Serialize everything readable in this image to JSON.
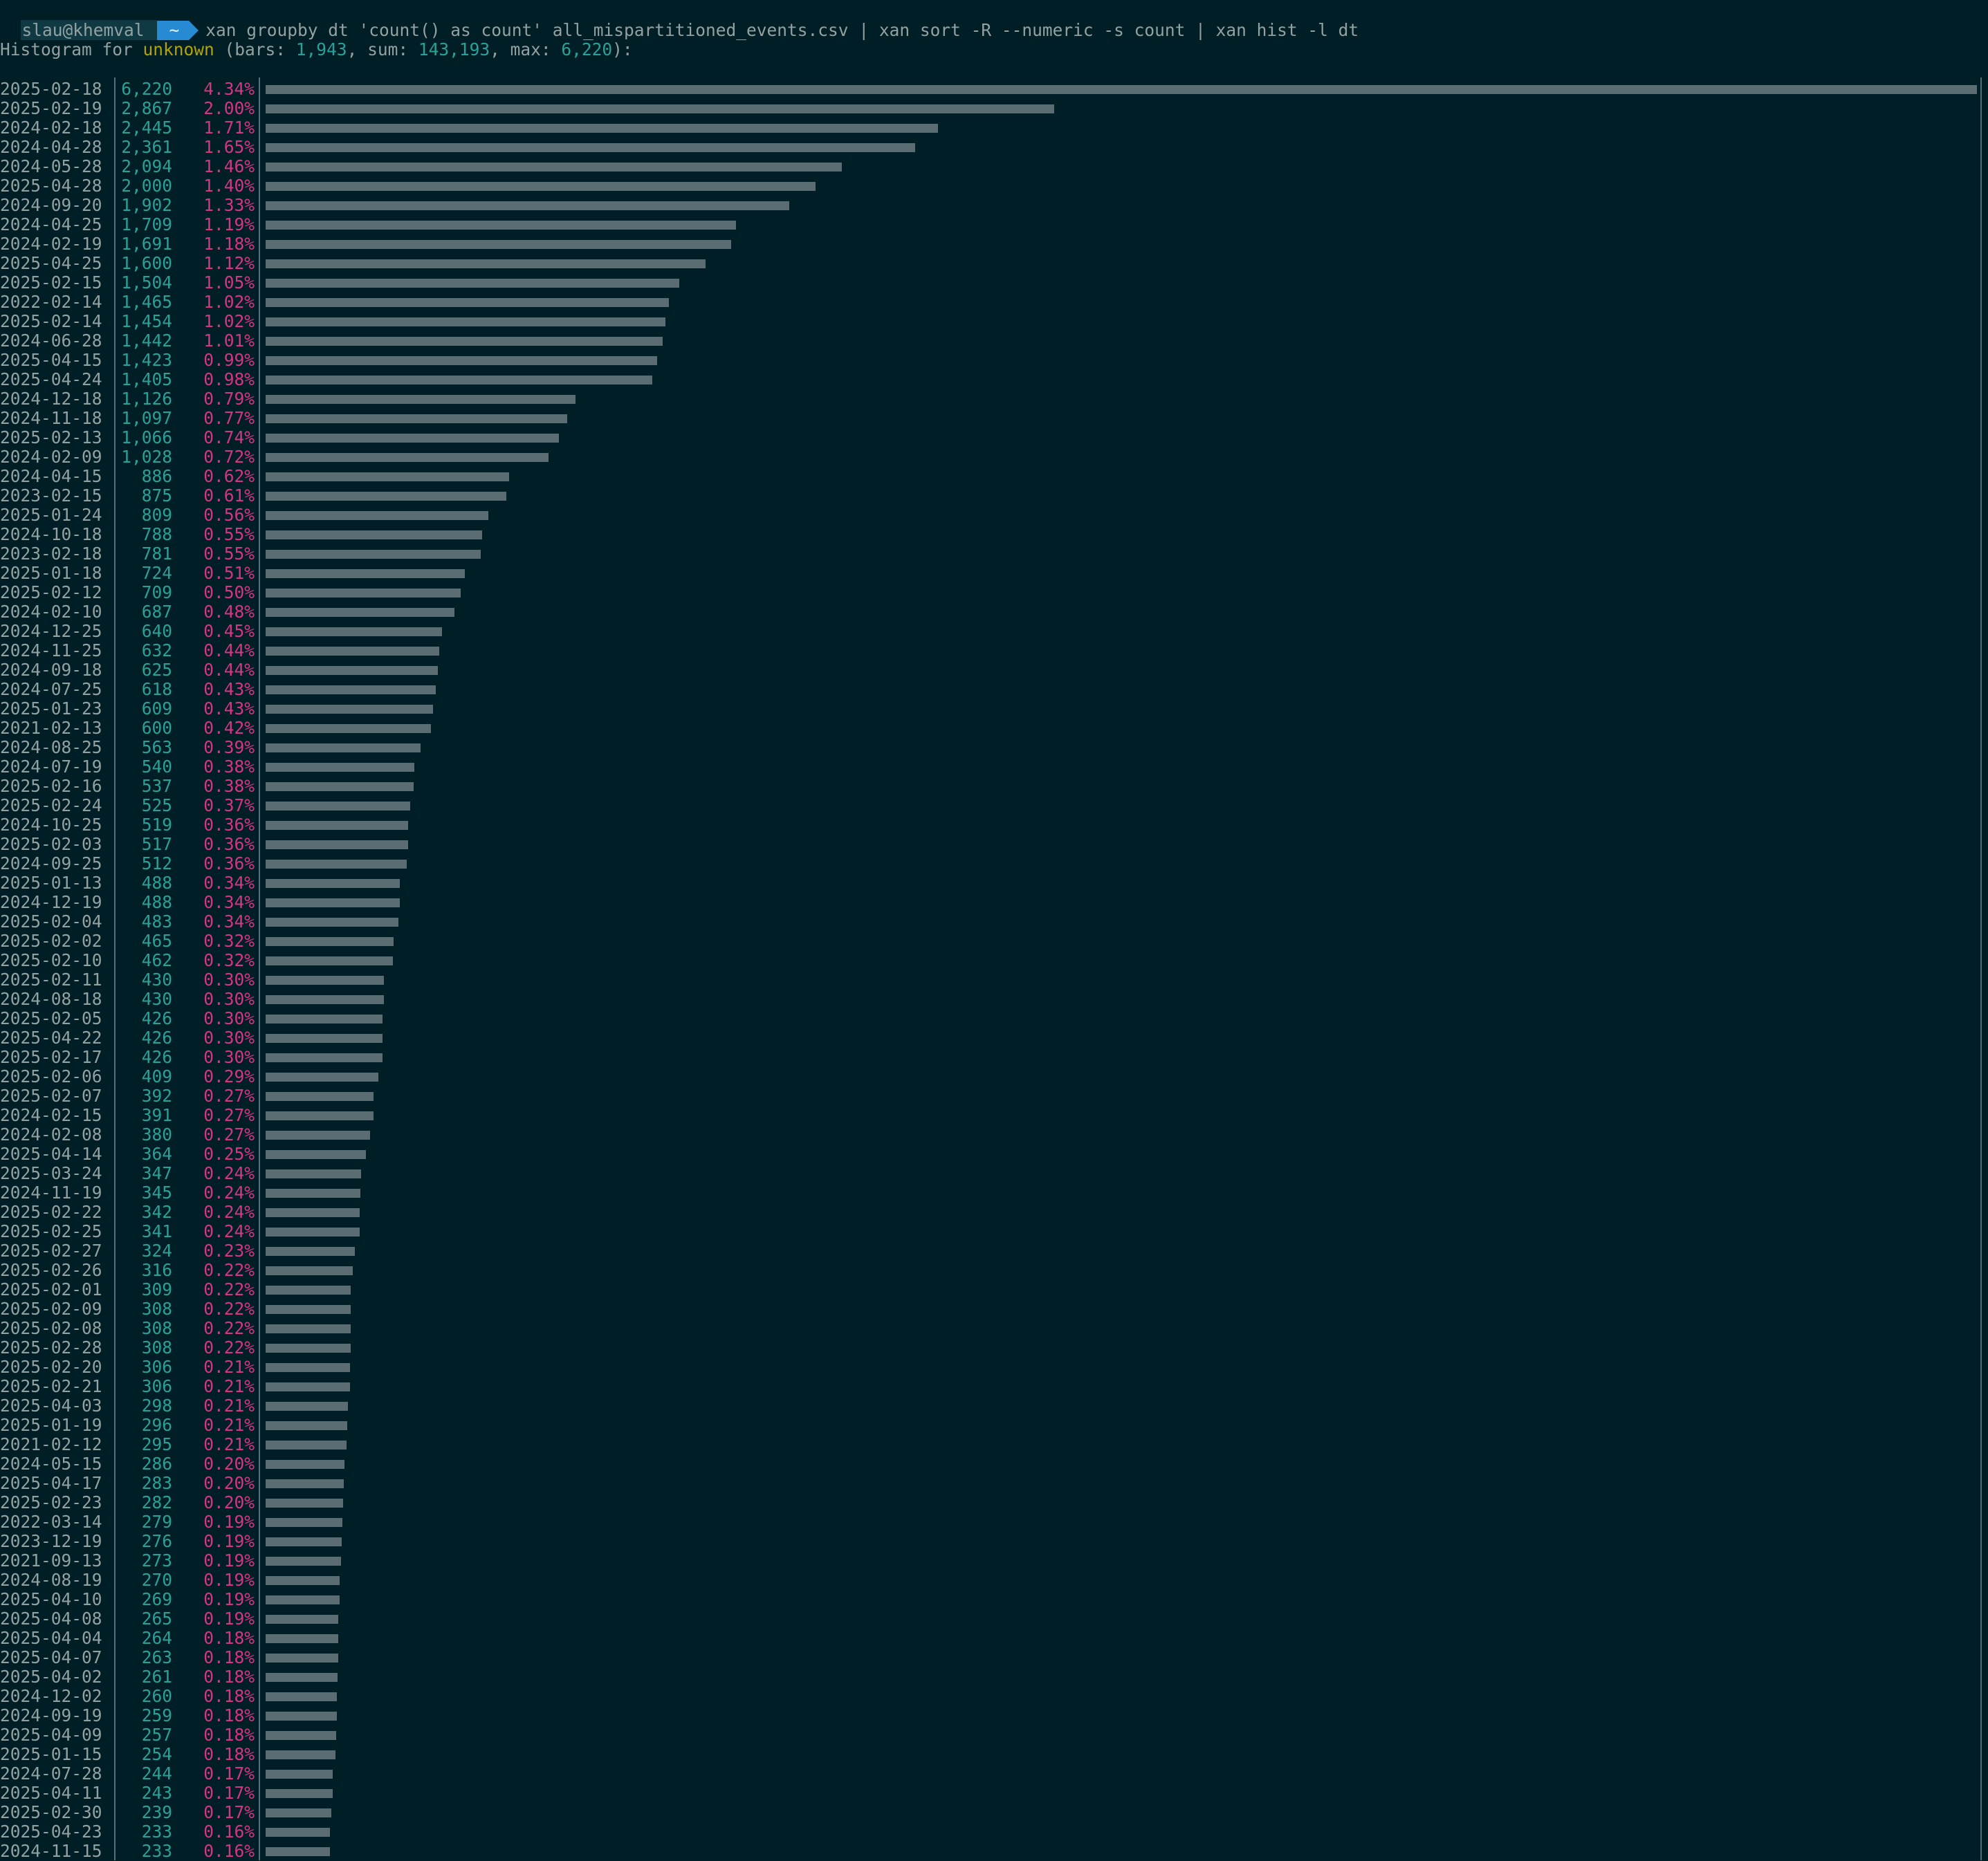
{
  "prompt": {
    "user": "slau@khemval",
    "dir": "~",
    "command": "xan groupby dt 'count() as count' all_mispartitioned_events.csv | xan sort -R --numeric -s count | xan hist -l dt"
  },
  "header": {
    "prefix": "Histogram for ",
    "field": "unknown",
    "bars_label": " (bars: ",
    "bars": "1,943",
    "sum_label": ", sum: ",
    "sum": "143,193",
    "max_label": ", max: ",
    "max": "6,220",
    "suffix": "):"
  },
  "colors": {
    "background": "#001e26",
    "text": "#93a1a1",
    "count": "#2aa198",
    "percent": "#d33682",
    "field": "#b5a300",
    "bar": "#5b6d73",
    "prompt_dir": "#268bd2"
  },
  "chart_data": {
    "type": "bar",
    "max": 6220,
    "sum": 143193,
    "bars": 1943,
    "rows": [
      {
        "label": "2025-02-18",
        "count": 6220,
        "count_text": "6,220",
        "pct": "4.34%"
      },
      {
        "label": "2025-02-19",
        "count": 2867,
        "count_text": "2,867",
        "pct": "2.00%"
      },
      {
        "label": "2024-02-18",
        "count": 2445,
        "count_text": "2,445",
        "pct": "1.71%"
      },
      {
        "label": "2024-04-28",
        "count": 2361,
        "count_text": "2,361",
        "pct": "1.65%"
      },
      {
        "label": "2024-05-28",
        "count": 2094,
        "count_text": "2,094",
        "pct": "1.46%"
      },
      {
        "label": "2025-04-28",
        "count": 2000,
        "count_text": "2,000",
        "pct": "1.40%"
      },
      {
        "label": "2024-09-20",
        "count": 1902,
        "count_text": "1,902",
        "pct": "1.33%"
      },
      {
        "label": "2024-04-25",
        "count": 1709,
        "count_text": "1,709",
        "pct": "1.19%"
      },
      {
        "label": "2024-02-19",
        "count": 1691,
        "count_text": "1,691",
        "pct": "1.18%"
      },
      {
        "label": "2025-04-25",
        "count": 1600,
        "count_text": "1,600",
        "pct": "1.12%"
      },
      {
        "label": "2025-02-15",
        "count": 1504,
        "count_text": "1,504",
        "pct": "1.05%"
      },
      {
        "label": "2022-02-14",
        "count": 1465,
        "count_text": "1,465",
        "pct": "1.02%"
      },
      {
        "label": "2025-02-14",
        "count": 1454,
        "count_text": "1,454",
        "pct": "1.02%"
      },
      {
        "label": "2024-06-28",
        "count": 1442,
        "count_text": "1,442",
        "pct": "1.01%"
      },
      {
        "label": "2025-04-15",
        "count": 1423,
        "count_text": "1,423",
        "pct": "0.99%"
      },
      {
        "label": "2025-04-24",
        "count": 1405,
        "count_text": "1,405",
        "pct": "0.98%"
      },
      {
        "label": "2024-12-18",
        "count": 1126,
        "count_text": "1,126",
        "pct": "0.79%"
      },
      {
        "label": "2024-11-18",
        "count": 1097,
        "count_text": "1,097",
        "pct": "0.77%"
      },
      {
        "label": "2025-02-13",
        "count": 1066,
        "count_text": "1,066",
        "pct": "0.74%"
      },
      {
        "label": "2024-02-09",
        "count": 1028,
        "count_text": "1,028",
        "pct": "0.72%"
      },
      {
        "label": "2024-04-15",
        "count": 886,
        "count_text": "886",
        "pct": "0.62%"
      },
      {
        "label": "2023-02-15",
        "count": 875,
        "count_text": "875",
        "pct": "0.61%"
      },
      {
        "label": "2025-01-24",
        "count": 809,
        "count_text": "809",
        "pct": "0.56%"
      },
      {
        "label": "2024-10-18",
        "count": 788,
        "count_text": "788",
        "pct": "0.55%"
      },
      {
        "label": "2023-02-18",
        "count": 781,
        "count_text": "781",
        "pct": "0.55%"
      },
      {
        "label": "2025-01-18",
        "count": 724,
        "count_text": "724",
        "pct": "0.51%"
      },
      {
        "label": "2025-02-12",
        "count": 709,
        "count_text": "709",
        "pct": "0.50%"
      },
      {
        "label": "2024-02-10",
        "count": 687,
        "count_text": "687",
        "pct": "0.48%"
      },
      {
        "label": "2024-12-25",
        "count": 640,
        "count_text": "640",
        "pct": "0.45%"
      },
      {
        "label": "2024-11-25",
        "count": 632,
        "count_text": "632",
        "pct": "0.44%"
      },
      {
        "label": "2024-09-18",
        "count": 625,
        "count_text": "625",
        "pct": "0.44%"
      },
      {
        "label": "2024-07-25",
        "count": 618,
        "count_text": "618",
        "pct": "0.43%"
      },
      {
        "label": "2025-01-23",
        "count": 609,
        "count_text": "609",
        "pct": "0.43%"
      },
      {
        "label": "2021-02-13",
        "count": 600,
        "count_text": "600",
        "pct": "0.42%"
      },
      {
        "label": "2024-08-25",
        "count": 563,
        "count_text": "563",
        "pct": "0.39%"
      },
      {
        "label": "2024-07-19",
        "count": 540,
        "count_text": "540",
        "pct": "0.38%"
      },
      {
        "label": "2025-02-16",
        "count": 537,
        "count_text": "537",
        "pct": "0.38%"
      },
      {
        "label": "2025-02-24",
        "count": 525,
        "count_text": "525",
        "pct": "0.37%"
      },
      {
        "label": "2024-10-25",
        "count": 519,
        "count_text": "519",
        "pct": "0.36%"
      },
      {
        "label": "2025-02-03",
        "count": 517,
        "count_text": "517",
        "pct": "0.36%"
      },
      {
        "label": "2024-09-25",
        "count": 512,
        "count_text": "512",
        "pct": "0.36%"
      },
      {
        "label": "2025-01-13",
        "count": 488,
        "count_text": "488",
        "pct": "0.34%"
      },
      {
        "label": "2024-12-19",
        "count": 488,
        "count_text": "488",
        "pct": "0.34%"
      },
      {
        "label": "2025-02-04",
        "count": 483,
        "count_text": "483",
        "pct": "0.34%"
      },
      {
        "label": "2025-02-02",
        "count": 465,
        "count_text": "465",
        "pct": "0.32%"
      },
      {
        "label": "2025-02-10",
        "count": 462,
        "count_text": "462",
        "pct": "0.32%"
      },
      {
        "label": "2025-02-11",
        "count": 430,
        "count_text": "430",
        "pct": "0.30%"
      },
      {
        "label": "2024-08-18",
        "count": 430,
        "count_text": "430",
        "pct": "0.30%"
      },
      {
        "label": "2025-02-05",
        "count": 426,
        "count_text": "426",
        "pct": "0.30%"
      },
      {
        "label": "2025-04-22",
        "count": 426,
        "count_text": "426",
        "pct": "0.30%"
      },
      {
        "label": "2025-02-17",
        "count": 426,
        "count_text": "426",
        "pct": "0.30%"
      },
      {
        "label": "2025-02-06",
        "count": 409,
        "count_text": "409",
        "pct": "0.29%"
      },
      {
        "label": "2025-02-07",
        "count": 392,
        "count_text": "392",
        "pct": "0.27%"
      },
      {
        "label": "2024-02-15",
        "count": 391,
        "count_text": "391",
        "pct": "0.27%"
      },
      {
        "label": "2024-02-08",
        "count": 380,
        "count_text": "380",
        "pct": "0.27%"
      },
      {
        "label": "2025-04-14",
        "count": 364,
        "count_text": "364",
        "pct": "0.25%"
      },
      {
        "label": "2025-03-24",
        "count": 347,
        "count_text": "347",
        "pct": "0.24%"
      },
      {
        "label": "2024-11-19",
        "count": 345,
        "count_text": "345",
        "pct": "0.24%"
      },
      {
        "label": "2025-02-22",
        "count": 342,
        "count_text": "342",
        "pct": "0.24%"
      },
      {
        "label": "2025-02-25",
        "count": 341,
        "count_text": "341",
        "pct": "0.24%"
      },
      {
        "label": "2025-02-27",
        "count": 324,
        "count_text": "324",
        "pct": "0.23%"
      },
      {
        "label": "2025-02-26",
        "count": 316,
        "count_text": "316",
        "pct": "0.22%"
      },
      {
        "label": "2025-02-01",
        "count": 309,
        "count_text": "309",
        "pct": "0.22%"
      },
      {
        "label": "2025-02-09",
        "count": 308,
        "count_text": "308",
        "pct": "0.22%"
      },
      {
        "label": "2025-02-08",
        "count": 308,
        "count_text": "308",
        "pct": "0.22%"
      },
      {
        "label": "2025-02-28",
        "count": 308,
        "count_text": "308",
        "pct": "0.22%"
      },
      {
        "label": "2025-02-20",
        "count": 306,
        "count_text": "306",
        "pct": "0.21%"
      },
      {
        "label": "2025-02-21",
        "count": 306,
        "count_text": "306",
        "pct": "0.21%"
      },
      {
        "label": "2025-04-03",
        "count": 298,
        "count_text": "298",
        "pct": "0.21%"
      },
      {
        "label": "2025-01-19",
        "count": 296,
        "count_text": "296",
        "pct": "0.21%"
      },
      {
        "label": "2021-02-12",
        "count": 295,
        "count_text": "295",
        "pct": "0.21%"
      },
      {
        "label": "2024-05-15",
        "count": 286,
        "count_text": "286",
        "pct": "0.20%"
      },
      {
        "label": "2025-04-17",
        "count": 283,
        "count_text": "283",
        "pct": "0.20%"
      },
      {
        "label": "2025-02-23",
        "count": 282,
        "count_text": "282",
        "pct": "0.20%"
      },
      {
        "label": "2022-03-14",
        "count": 279,
        "count_text": "279",
        "pct": "0.19%"
      },
      {
        "label": "2023-12-19",
        "count": 276,
        "count_text": "276",
        "pct": "0.19%"
      },
      {
        "label": "2021-09-13",
        "count": 273,
        "count_text": "273",
        "pct": "0.19%"
      },
      {
        "label": "2024-08-19",
        "count": 270,
        "count_text": "270",
        "pct": "0.19%"
      },
      {
        "label": "2025-04-10",
        "count": 269,
        "count_text": "269",
        "pct": "0.19%"
      },
      {
        "label": "2025-04-08",
        "count": 265,
        "count_text": "265",
        "pct": "0.19%"
      },
      {
        "label": "2025-04-04",
        "count": 264,
        "count_text": "264",
        "pct": "0.18%"
      },
      {
        "label": "2025-04-07",
        "count": 263,
        "count_text": "263",
        "pct": "0.18%"
      },
      {
        "label": "2025-04-02",
        "count": 261,
        "count_text": "261",
        "pct": "0.18%"
      },
      {
        "label": "2024-12-02",
        "count": 260,
        "count_text": "260",
        "pct": "0.18%"
      },
      {
        "label": "2024-09-19",
        "count": 259,
        "count_text": "259",
        "pct": "0.18%"
      },
      {
        "label": "2025-04-09",
        "count": 257,
        "count_text": "257",
        "pct": "0.18%"
      },
      {
        "label": "2025-01-15",
        "count": 254,
        "count_text": "254",
        "pct": "0.18%"
      },
      {
        "label": "2024-07-28",
        "count": 244,
        "count_text": "244",
        "pct": "0.17%"
      },
      {
        "label": "2025-04-11",
        "count": 243,
        "count_text": "243",
        "pct": "0.17%"
      },
      {
        "label": "2025-02-30",
        "count": 239,
        "count_text": "239",
        "pct": "0.17%"
      },
      {
        "label": "2025-04-23",
        "count": 233,
        "count_text": "233",
        "pct": "0.16%"
      },
      {
        "label": "2024-11-15",
        "count": 233,
        "count_text": "233",
        "pct": "0.16%"
      }
    ]
  }
}
